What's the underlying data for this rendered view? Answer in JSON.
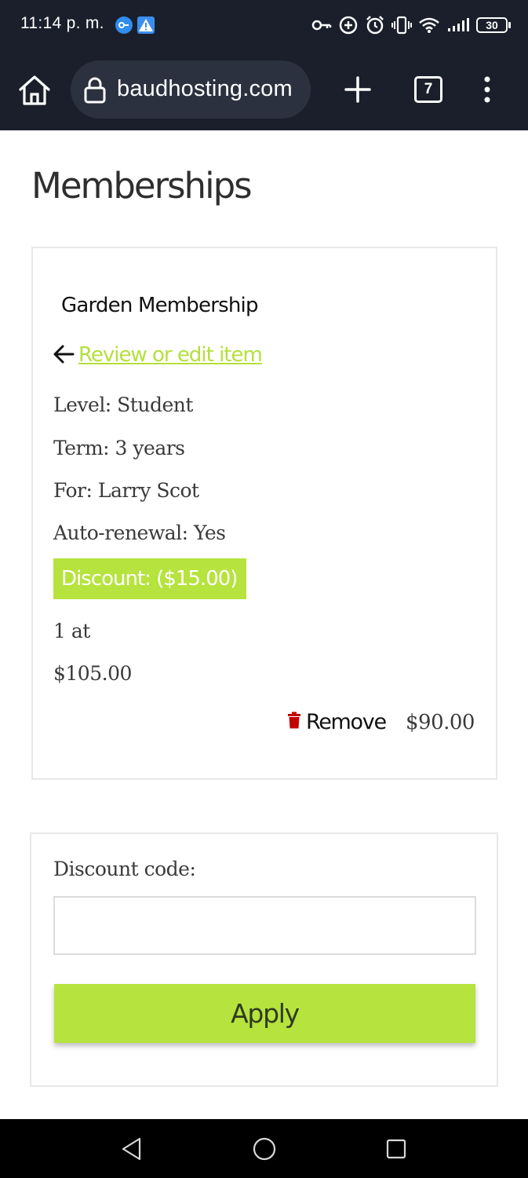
{
  "status_bar": {
    "time": "11:14 p. m.",
    "battery": "30"
  },
  "browser": {
    "url": "baudhosting.com",
    "tab_count": "7"
  },
  "page": {
    "title": "Memberships"
  },
  "cart_item": {
    "name": "Garden Membership",
    "review_link": "Review or edit item",
    "details": [
      "Level: Student",
      "Term: 3 years",
      "For: Larry Scot",
      "Auto-renewal: Yes"
    ],
    "discount_badge": "Discount: ($15.00)",
    "quantity_text": "1 at",
    "unit_price": "$105.00",
    "remove_label": "Remove",
    "line_total": "$90.00"
  },
  "discount": {
    "label": "Discount code:",
    "value": "",
    "apply_label": "Apply"
  },
  "colors": {
    "accent": "#b6e33d",
    "system_bar": "#1b1f2b",
    "remove_icon": "#c40000"
  }
}
